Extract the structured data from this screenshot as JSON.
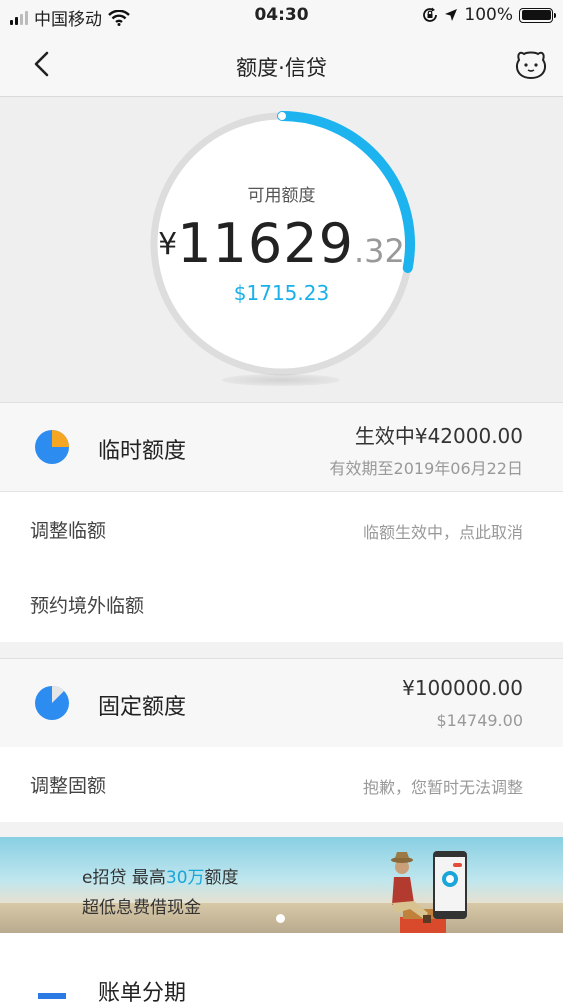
{
  "status_bar": {
    "carrier": "中国移动",
    "time": "04:30",
    "battery": "100%"
  },
  "nav": {
    "title": "额度·信贷"
  },
  "gauge": {
    "label": "可用额度",
    "currency": "¥",
    "amount_int": "11629",
    "amount_dec": ".32",
    "usd": "$1715.23",
    "used_fraction": 0.28,
    "accent_color": "#1cb3ee"
  },
  "temp_limit": {
    "title": "临时额度",
    "value": "生效中¥42000.00",
    "expiry": "有效期至2019年06月22日",
    "rows": [
      {
        "label": "调整临额",
        "hint": "临额生效中，点此取消"
      },
      {
        "label": "预约境外临额",
        "hint": ""
      }
    ]
  },
  "fixed_limit": {
    "title": "固定额度",
    "value": "¥100000.00",
    "usd": "$14749.00",
    "rows": [
      {
        "label": "调整固额",
        "hint": "抱歉，您暂时无法调整"
      }
    ]
  },
  "banner": {
    "line1_prefix": "e招贷  最高",
    "line1_highlight": "30万",
    "line1_suffix": "额度",
    "line2": "超低息费借现金"
  },
  "installment": {
    "title": "账单分期"
  }
}
